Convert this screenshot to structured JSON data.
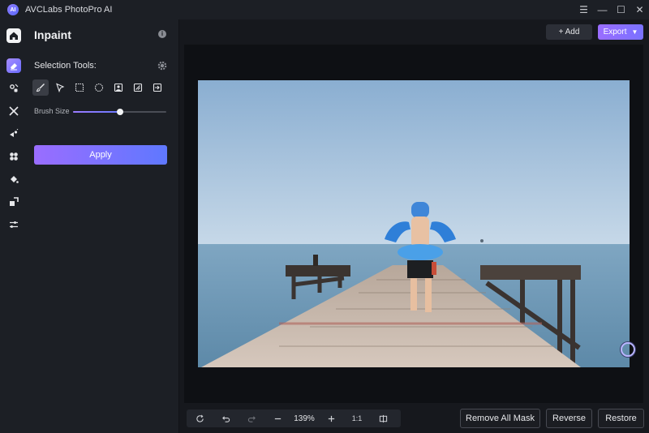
{
  "window": {
    "title": "AVCLabs PhotoPro AI",
    "logo_text": "AI",
    "controls": [
      "☰",
      "—",
      "☐",
      "✕"
    ]
  },
  "panel": {
    "title": "Inpaint",
    "selection_label": "Selection Tools:",
    "brush_size_label": "Brush Size",
    "brush_size_fraction": 0.5,
    "apply_label": "Apply"
  },
  "toolbar": {
    "add_label": "+ Add",
    "export_label": "Export"
  },
  "zoom": {
    "value": "139%",
    "actual_size": "1:1"
  },
  "actions": {
    "remove_mask": "Remove All Mask",
    "reverse": "Reverse",
    "restore": "Restore"
  },
  "colors": {
    "accent": "#7b6dff",
    "background": "#16181d",
    "panel": "#1c1f25"
  }
}
